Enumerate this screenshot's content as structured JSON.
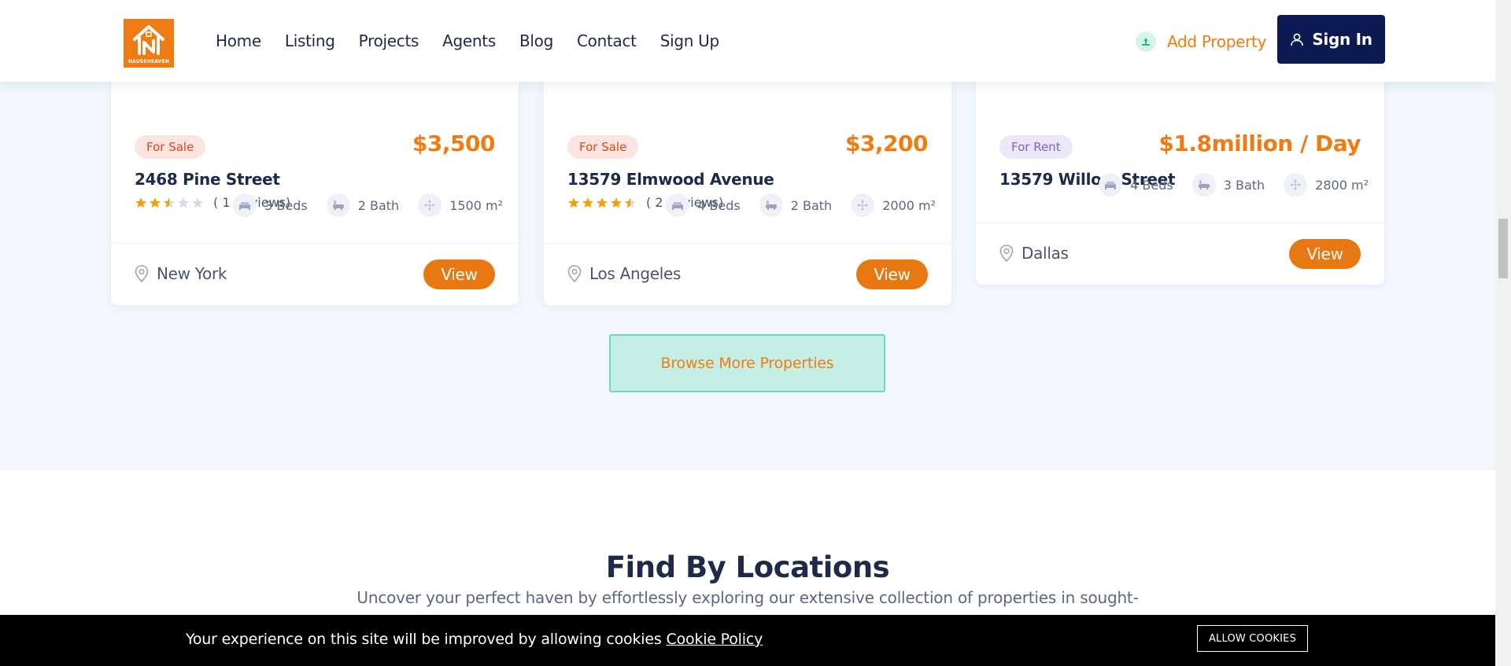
{
  "header": {
    "logo_text": "HAUSEHEAVEN",
    "nav": [
      "Home",
      "Listing",
      "Projects",
      "Agents",
      "Blog",
      "Contact",
      "Sign Up"
    ],
    "add_property": "Add Property",
    "sign_in": "Sign In"
  },
  "listings": [
    {
      "badge": "For Sale",
      "price": "$3,500",
      "title": "2468 Pine Street",
      "rating": 2.5,
      "reviews": "( 1 Reviews)",
      "beds": "3 Beds",
      "baths": "2 Bath",
      "area": "1500 m²",
      "location": "New York",
      "view": "View"
    },
    {
      "badge": "For Sale",
      "price": "$3,200",
      "title": "13579 Elmwood Avenue",
      "rating": 4.5,
      "reviews": "( 2 Reviews)",
      "beds": "4 Beds",
      "baths": "2 Bath",
      "area": "2000 m²",
      "location": "Los Angeles",
      "view": "View"
    },
    {
      "badge": "For Rent",
      "price": "$1.8million / Day",
      "title": "13579 Willow Street",
      "beds": "4 Beds",
      "baths": "3 Bath",
      "area": "2800 m²",
      "location": "Dallas",
      "view": "View"
    }
  ],
  "browse_more": "Browse More Properties",
  "locations": {
    "title": "Find By Locations",
    "subtitle": "Uncover your perfect haven by effortlessly exploring our extensive collection of properties in sought-"
  },
  "cookie": {
    "text": "Your experience on this site will be improved by allowing cookies",
    "link": "Cookie Policy",
    "button": "ALLOW COOKIES"
  },
  "colors": {
    "accent": "#ef7c13",
    "navy": "#0c1a52",
    "star": "#f59e0b"
  }
}
